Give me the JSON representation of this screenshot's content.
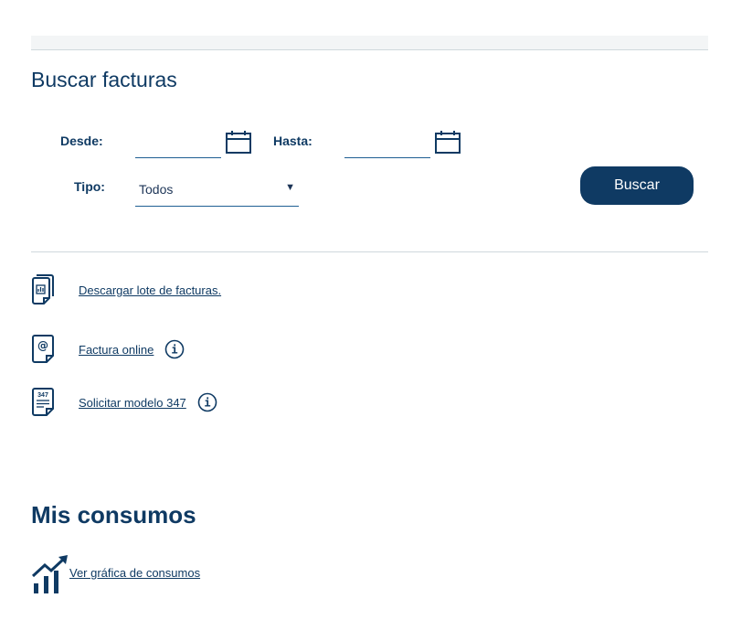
{
  "search": {
    "title": "Buscar facturas",
    "desde_label": "Desde:",
    "hasta_label": "Hasta:",
    "desde_value": "",
    "hasta_value": "",
    "tipo_label": "Tipo:",
    "tipo_selected": "Todos",
    "button_label": "Buscar"
  },
  "links": [
    {
      "label": "Descargar lote de facturas.",
      "icon": "document-chart-icon",
      "has_info": false
    },
    {
      "label": "Factura online",
      "icon": "document-email-icon",
      "has_info": true
    },
    {
      "label": "Solicitar modelo 347",
      "icon": "document-347-icon",
      "has_info": true
    }
  ],
  "doc347_badge": "347",
  "consumos": {
    "title": "Mis consumos",
    "link_label": "Ver gráfica de consumos"
  },
  "colors": {
    "primary": "#0f3a63",
    "divider": "#cfd8dc",
    "underline": "#1f5f93"
  }
}
